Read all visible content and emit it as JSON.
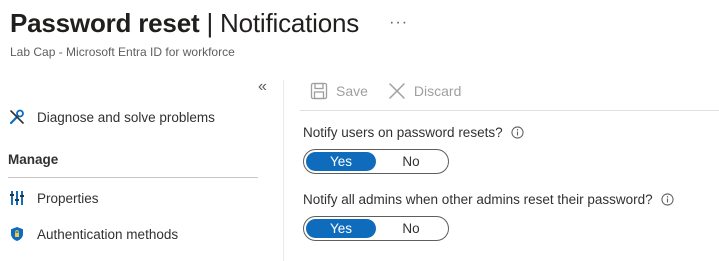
{
  "header": {
    "title_main": "Password reset",
    "title_sep": " | ",
    "title_section": "Notifications",
    "more_label": "···",
    "subtitle": "Lab Cap - Microsoft Entra ID for workforce"
  },
  "sidebar": {
    "collapse_label": "«",
    "diagnose_label": "Diagnose and solve problems",
    "section_label": "Manage",
    "items": [
      {
        "label": "Properties",
        "icon": "properties-icon"
      },
      {
        "label": "Authentication methods",
        "icon": "shield-icon"
      }
    ]
  },
  "toolbar": {
    "save_label": "Save",
    "discard_label": "Discard"
  },
  "settings": [
    {
      "label": "Notify users on password resets?",
      "yes": "Yes",
      "no": "No",
      "selected": "Yes"
    },
    {
      "label": "Notify all admins when other admins reset their password?",
      "yes": "Yes",
      "no": "No",
      "selected": "Yes"
    }
  ],
  "colors": {
    "accent": "#0f6cbd",
    "disabled_text": "#a19f9d"
  }
}
